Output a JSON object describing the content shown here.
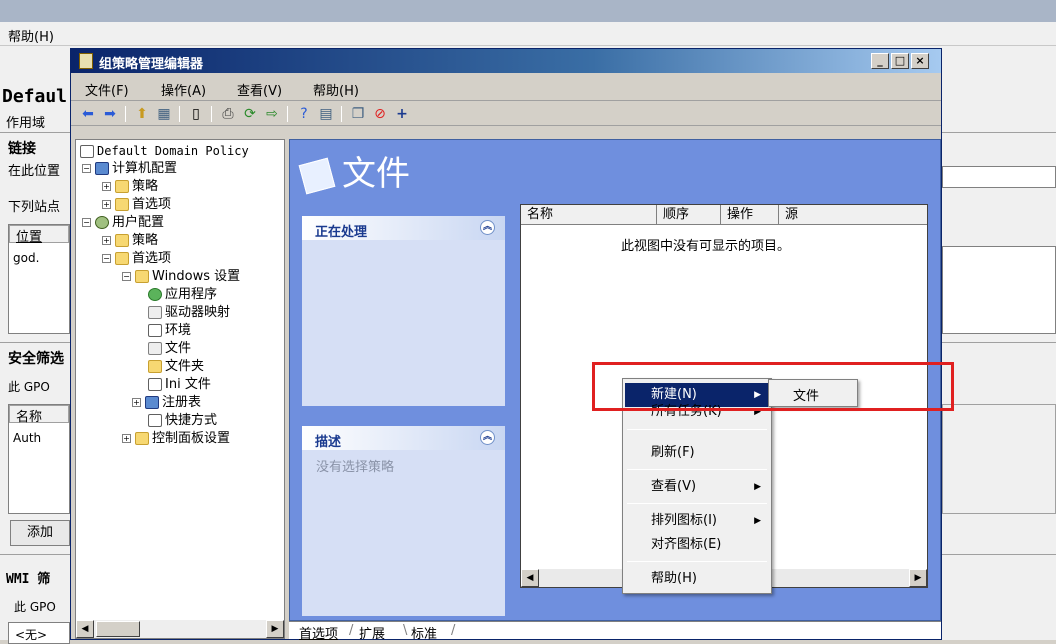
{
  "background_app": {
    "menu_help": "帮助(H)",
    "domain_label": "Defaul",
    "scope_tab": "作用域",
    "links_heading": "链接",
    "links_desc": "在此位置",
    "sites_desc": "下列站点",
    "location_col": "位置",
    "link_item": "god.",
    "security_heading": "安全筛选",
    "security_desc": "此 GPO",
    "name_col": "名称",
    "auth_item": "Auth",
    "add_button": "添加",
    "wmi_heading": "WMI 筛",
    "wmi_desc": "此 GPO",
    "wmi_value": "<无>"
  },
  "window": {
    "title": "组策略管理编辑器",
    "controls": [
      "_",
      "□",
      "×"
    ]
  },
  "menu": [
    "文件(F)",
    "操作(A)",
    "查看(V)",
    "帮助(H)"
  ],
  "tree": {
    "root": "Default Domain Policy",
    "computer_config": "计算机配置",
    "c_policies": "策略",
    "c_preferences": "首选项",
    "user_config": "用户配置",
    "u_policies": "策略",
    "u_preferences": "首选项",
    "windows_settings": "Windows 设置",
    "applications": "应用程序",
    "drive_maps": "驱动器映射",
    "environment": "环境",
    "files": "文件",
    "folders": "文件夹",
    "ini_files": "Ini 文件",
    "registry": "注册表",
    "shortcuts": "快捷方式",
    "control_panel": "控制面板设置"
  },
  "panel": {
    "title": "文件",
    "processing_header": "正在处理",
    "description_header": "描述",
    "description_text": "没有选择策略",
    "columns": [
      "名称",
      "顺序",
      "操作",
      "源"
    ],
    "empty_message": "此视图中没有可显示的项目。",
    "tabs": [
      "首选项",
      "扩展",
      "标准"
    ]
  },
  "context_menu": {
    "items": [
      "新建(N)",
      "所有任务(K)",
      "刷新(F)",
      "查看(V)",
      "排列图标(I)",
      "对齐图标(E)",
      "帮助(H)"
    ],
    "submenu_item": "文件"
  },
  "colors": {
    "panel_blue": "#6f8fde",
    "highlight": "#0a246a",
    "annotation_red": "#e02020"
  }
}
